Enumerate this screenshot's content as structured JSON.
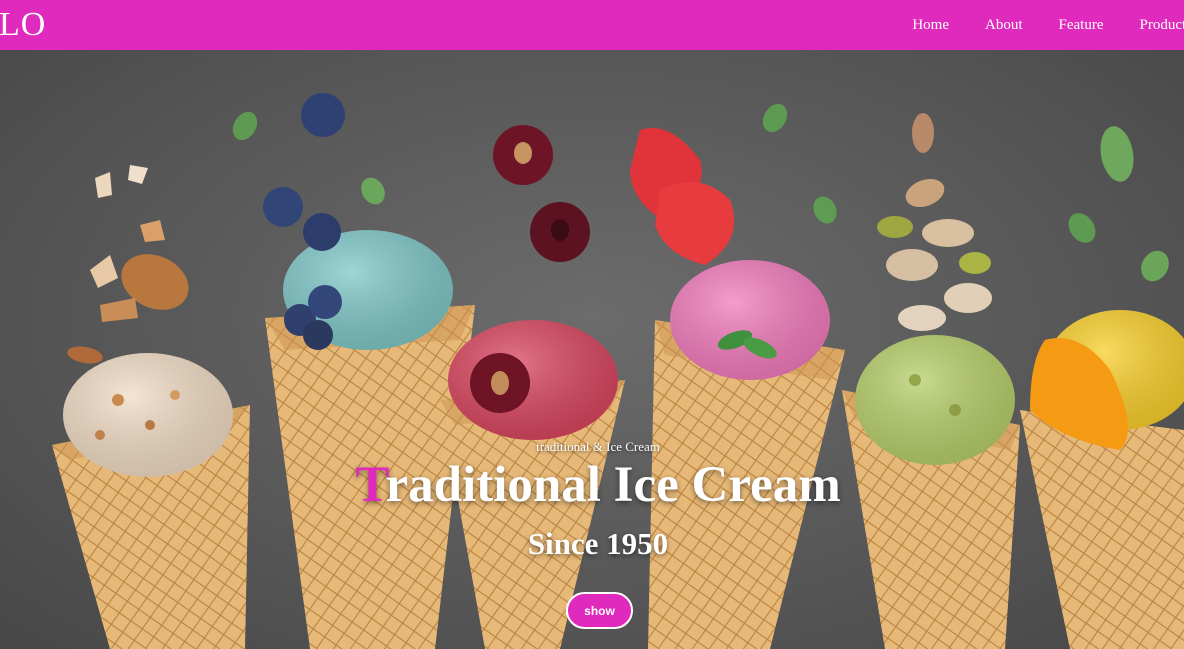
{
  "brand": {
    "logo_text": "LO",
    "accent_color": "#e02abd"
  },
  "nav": {
    "items": [
      {
        "label": "Home"
      },
      {
        "label": "About"
      },
      {
        "label": "Feature"
      },
      {
        "label": "Products"
      }
    ]
  },
  "hero": {
    "tagline": "traditional & Ice Cream",
    "headline_first_letter": "T",
    "headline_rest": "raditional Ice Cream",
    "subheadline": "Since 1950",
    "button_label": "show",
    "background_image": "ice-cream-cones-photo"
  }
}
